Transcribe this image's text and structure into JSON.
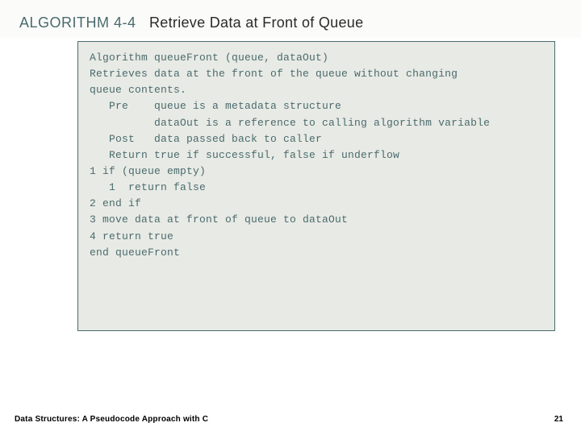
{
  "header": {
    "algorithm_label": "ALGORITHM 4-4",
    "title": "Retrieve Data at Front of Queue"
  },
  "code": {
    "lines": [
      "Algorithm queueFront (queue, dataOut)",
      "Retrieves data at the front of the queue without changing",
      "queue contents.",
      "   Pre    queue is a metadata structure",
      "          dataOut is a reference to calling algorithm variable",
      "   Post   data passed back to caller",
      "   Return true if successful, false if underflow",
      "1 if (queue empty)",
      "   1  return false",
      "2 end if",
      "3 move data at front of queue to dataOut",
      "4 return true",
      "end queueFront"
    ]
  },
  "footer": {
    "text": "Data Structures: A Pseudocode Approach with C",
    "page": "21"
  }
}
